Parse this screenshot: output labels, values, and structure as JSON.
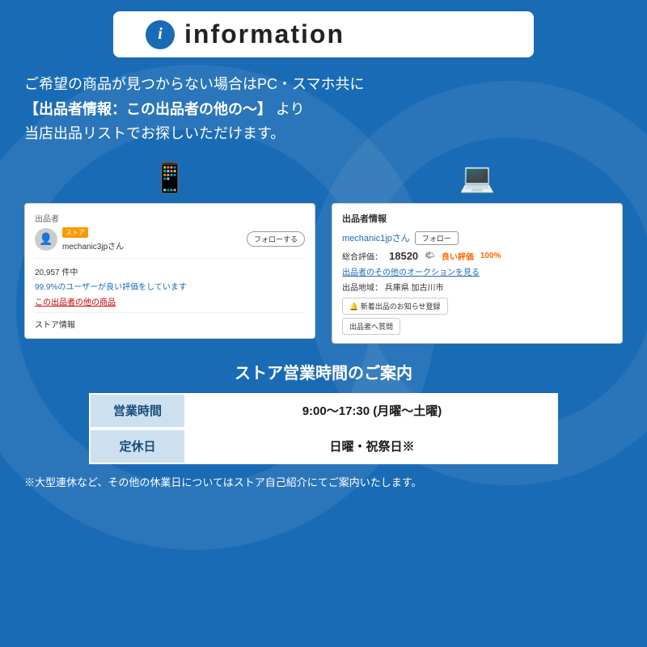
{
  "header": {
    "icon_char": "i",
    "title": "information"
  },
  "description": {
    "line1": "ご希望の商品が見つからない場合はPC・スマホ共に",
    "line2_pre": "【出品者情報：この出品者の他の〜】",
    "line2_post": " より",
    "line3": "当店出品リストでお探しいただけます。"
  },
  "mobile_screenshot": {
    "seller_label": "出品者",
    "store_badge": "ストア",
    "seller_name": "mechanic3jpさん",
    "follow_btn": "フォローする",
    "count": "20,957 件中",
    "rating": "99.9%のユーザーが良い評価をしています",
    "other_items": "この出品者の他の商品",
    "store_info": "ストア情報"
  },
  "pc_screenshot": {
    "header": "出品者情報",
    "seller_name": "mechanic1jpさん",
    "follow_btn": "フォロー",
    "rating_label": "総合評価：",
    "rating_number": "18520",
    "good_label": "良い評価",
    "good_percent": "100%",
    "auction_link": "出品者のその他のオークションを見る",
    "location_label": "出品地域：",
    "location": "兵庫県 加古川市",
    "notify_btn": "🔔 新着出品のお知らせ登録",
    "question_btn": "出品者へ質問"
  },
  "store_hours": {
    "title": "ストア営業時間のご案内",
    "rows": [
      {
        "label": "営業時間",
        "value": "9:00〜17:30 (月曜〜土曜)"
      },
      {
        "label": "定休日",
        "value": "日曜・祝祭日※"
      }
    ]
  },
  "footer": {
    "note": "※大型連休など、その他の休業日についてはストア自己紹介にてご案内いたします。"
  },
  "colors": {
    "bg_blue": "#1a6bb5",
    "light_blue_cell": "#cce0f0",
    "text_blue": "#1a4a7a"
  }
}
